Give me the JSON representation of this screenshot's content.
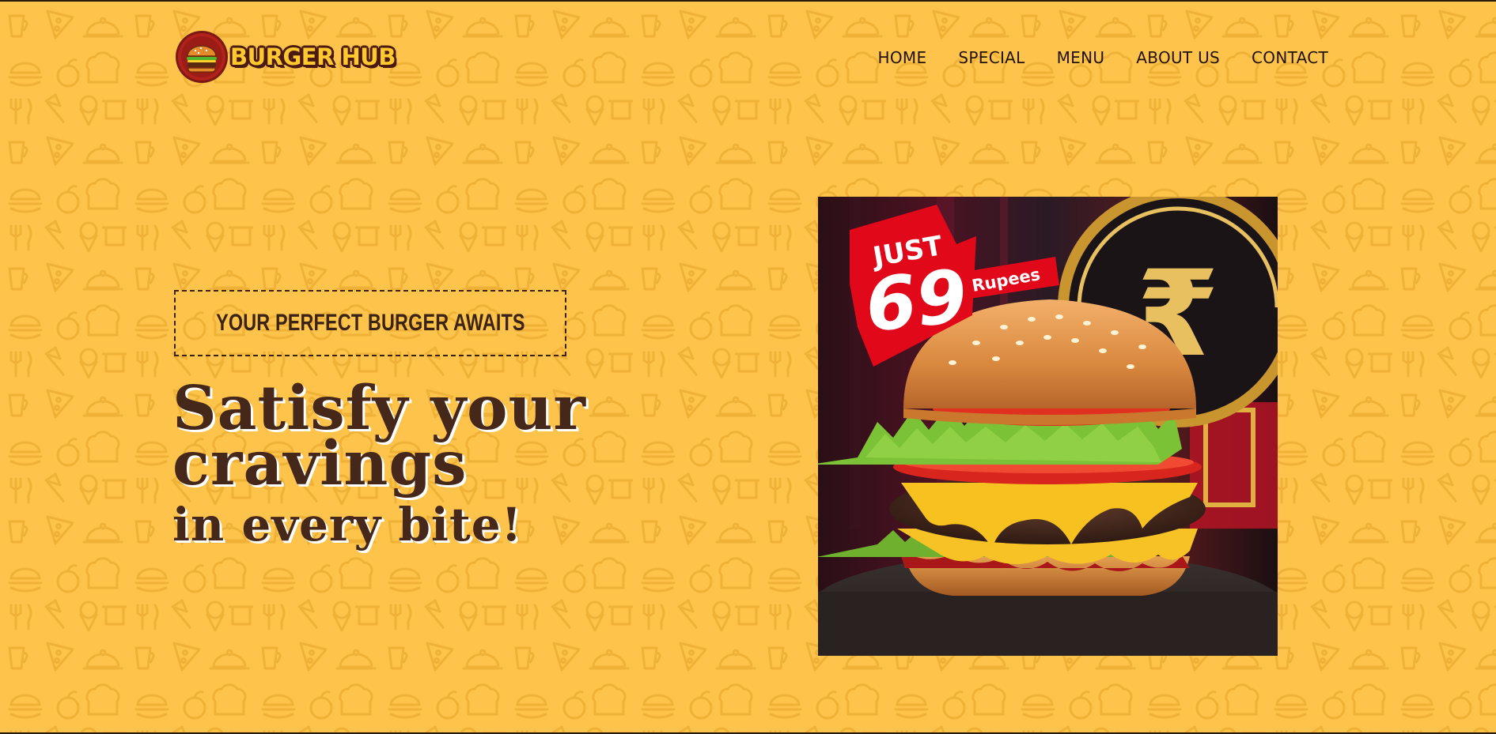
{
  "brand": {
    "name": "BURGER HUB"
  },
  "nav": {
    "items": [
      "HOME",
      "SPECIAL",
      "MENU",
      "ABOUT US",
      "CONTACT"
    ]
  },
  "hero": {
    "tagline": "YOUR PERFECT BURGER AWAITS",
    "headline": {
      "line1": "Satisfy your",
      "line2": "cravings",
      "line3": "in every bite!"
    }
  },
  "promo": {
    "prefix": "JUST",
    "price": "69",
    "currency": "Rupees",
    "currency_symbol": "₹"
  },
  "colors": {
    "background": "#FEC34B",
    "pattern": "#F2B43A",
    "text_dark": "#45281A",
    "badge_red": "#E1081A",
    "logo_yellow": "#FFC82F"
  },
  "icons": [
    "burger-logo-icon",
    "food-doodle-pattern"
  ]
}
